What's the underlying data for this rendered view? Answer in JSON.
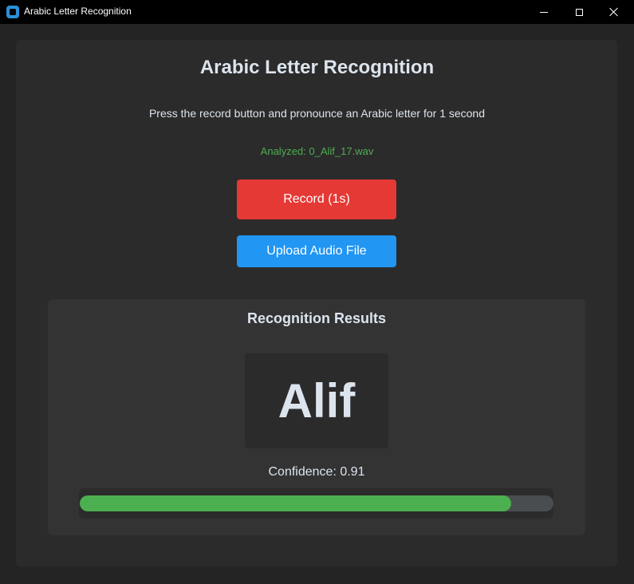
{
  "window": {
    "title": "Arabic Letter Recognition",
    "icon": "app-icon"
  },
  "main": {
    "heading": "Arabic Letter Recognition",
    "instructions": "Press the record button and pronounce an Arabic letter for 1 second",
    "status": "Analyzed: 0_Alif_17.wav",
    "record_label": "Record (1s)",
    "upload_label": "Upload Audio File"
  },
  "results": {
    "title": "Recognition Results",
    "letter": "Alif",
    "confidence_text": "Confidence: 0.91",
    "confidence_value": 0.91
  },
  "colors": {
    "background": "#242424",
    "record_button": "#e53935",
    "upload_button": "#2196f3",
    "success_text": "#4caf50",
    "progress_fill": "#4caf50"
  }
}
